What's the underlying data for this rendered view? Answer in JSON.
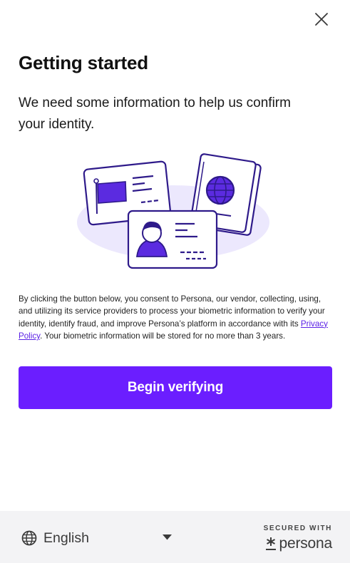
{
  "header": {
    "close_icon": "close-icon"
  },
  "main": {
    "title": "Getting started",
    "lead": "We need some information to help us confirm your identity.",
    "illustration_icon": "id-documents-illustration",
    "consent": {
      "text_before": "By clicking the button below, you consent to Persona, our vendor, collecting, using, and utilizing its service providers to process your biometric information to verify your identity, identify fraud, and improve Persona’s platform in accordance with its ",
      "link_label": "Privacy Policy",
      "text_after": ". Your biometric information will be stored for no more than 3 years."
    },
    "primary_button": "Begin verifying"
  },
  "footer": {
    "language": "English",
    "language_icon": "globe-icon",
    "secured_label": "SECURED WITH",
    "brand_name": "persona"
  },
  "colors": {
    "accent": "#6b1eff",
    "accent_light": "#ece8fd",
    "footer_bg": "#f3f3f5"
  }
}
